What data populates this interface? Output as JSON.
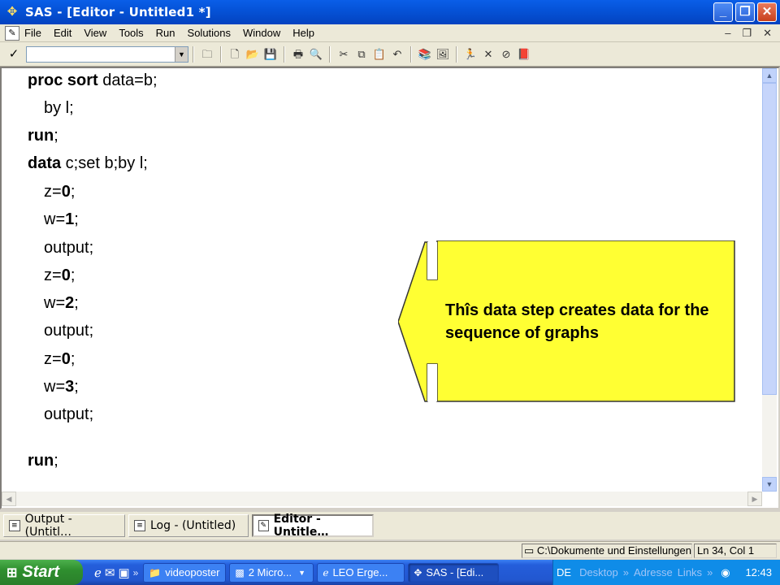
{
  "window": {
    "title": "SAS - [Editor - Untitled1 *]"
  },
  "menu": {
    "items": [
      "File",
      "Edit",
      "View",
      "Tools",
      "Run",
      "Solutions",
      "Window",
      "Help"
    ]
  },
  "toolbar": {
    "command_value": ""
  },
  "editor": {
    "lines": [
      {
        "kw": "proc sort",
        "rest": " data=b;",
        "indent": false
      },
      {
        "kw": "",
        "rest": "by l;",
        "indent": true
      },
      {
        "kw": "run",
        "rest": ";",
        "indent": false
      },
      {
        "kw": "data",
        "rest": " c;set b;by l;",
        "indent": false
      },
      {
        "kw": "",
        "rest": "z=0;",
        "indent": true,
        "bold_num": "0",
        "pre": "z=",
        "post": ";"
      },
      {
        "kw": "",
        "rest": "w=1;",
        "indent": true,
        "bold_num": "1",
        "pre": "w=",
        "post": ";"
      },
      {
        "kw": "",
        "rest": "output;",
        "indent": true
      },
      {
        "kw": "",
        "rest": "z=0;",
        "indent": true,
        "bold_num": "0",
        "pre": "z=",
        "post": ";"
      },
      {
        "kw": "",
        "rest": "w=2;",
        "indent": true,
        "bold_num": "2",
        "pre": "w=",
        "post": ";"
      },
      {
        "kw": "",
        "rest": "output;",
        "indent": true
      },
      {
        "kw": "",
        "rest": "z=0;",
        "indent": true,
        "bold_num": "0",
        "pre": "z=",
        "post": ";"
      },
      {
        "kw": "",
        "rest": "w=3;",
        "indent": true,
        "bold_num": "3",
        "pre": "w=",
        "post": ";"
      },
      {
        "kw": "",
        "rest": "output;",
        "indent": true
      },
      {
        "kw": "run",
        "rest": ";",
        "indent": false
      }
    ]
  },
  "callout": {
    "text": "Thîs data step creates data for the sequence of graphs",
    "color": "#ffff33"
  },
  "window_tabs": [
    {
      "label": "Output - (Untitl…",
      "active": false
    },
    {
      "label": "Log - (Untitled)",
      "active": false
    },
    {
      "label": "Editor - Untitle…",
      "active": true
    }
  ],
  "status": {
    "path": "C:\\Dokumente und Einstellungen\\",
    "position": "Ln 34, Col 1"
  },
  "taskbar": {
    "start_label": "Start",
    "tasks": [
      {
        "label": "videoposter",
        "icon": "folder-icon",
        "active": false
      },
      {
        "label": "2 Micro...",
        "icon": "office-icon",
        "active": false
      },
      {
        "label": "LEO Erge...",
        "icon": "ie-icon",
        "active": false
      },
      {
        "label": "SAS - [Edi...",
        "icon": "sas-icon",
        "active": true
      }
    ],
    "tray": {
      "lang": "DE",
      "desktop": "Desktop",
      "address": "Adresse",
      "links": "Links",
      "clock": "12:43"
    }
  }
}
